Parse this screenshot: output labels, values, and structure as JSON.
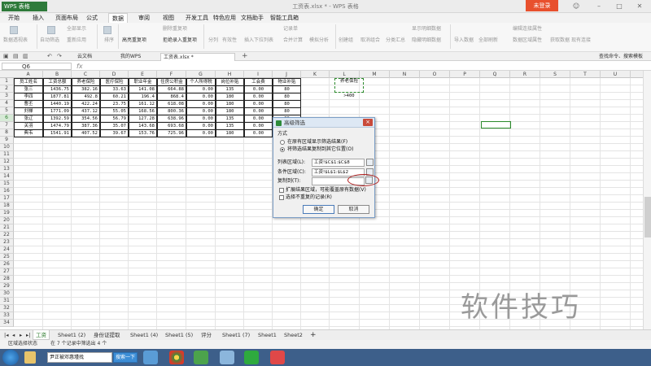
{
  "window": {
    "app_label": "WPS 表格",
    "title": "工资表.xlsx * - WPS 表格",
    "login_button": "未登录"
  },
  "menu": [
    "开始",
    "插入",
    "页面布局",
    "公式",
    "数据",
    "审阅",
    "视图",
    "开发工具",
    "特色应用",
    "文档助手",
    "智能工具箱"
  ],
  "ribbon": {
    "items": [
      "数据透视表",
      "自动筛选",
      "全部显示",
      "重新应用",
      "排序",
      "高亮重复项",
      "删除重复项",
      "拒绝录入重复项",
      "分列",
      "有效性",
      "插入下拉列表",
      "合并计算",
      "记录单",
      "模拟分析",
      "创建组",
      "取消组合",
      "分类汇总",
      "显示明细数据",
      "隐藏明细数据",
      "导入数据",
      "全部刷新",
      "编辑连接属性",
      "数据区域属性",
      "获取数据",
      "现有连接"
    ]
  },
  "quick_access_tabs": {
    "cloud": "云文档",
    "mywps": "我的WPS",
    "file": "工资表.xlsx *"
  },
  "name_box": "Q6",
  "fx_label": "fx",
  "search_hint": "查找命令、搜索模板",
  "columns": [
    "A",
    "B",
    "C",
    "D",
    "E",
    "F",
    "G",
    "H",
    "I",
    "J",
    "K",
    "L",
    "M",
    "N",
    "O",
    "P",
    "Q",
    "R",
    "S",
    "T",
    "U"
  ],
  "rows": [
    "1",
    "2",
    "3",
    "4",
    "5",
    "6",
    "7",
    "8",
    "9",
    "10",
    "11",
    "12",
    "13",
    "14",
    "15",
    "16",
    "17",
    "18",
    "19",
    "20",
    "21",
    "22",
    "23",
    "24",
    "25",
    "26",
    "27",
    "28",
    "29",
    "30",
    "31",
    "32",
    "33",
    "34"
  ],
  "table": {
    "headers": [
      "员工姓名",
      "工资总额",
      "养老保险",
      "医疗保险",
      "职业年金",
      "住房公积金",
      "个人所得税",
      "岗位补贴",
      "工会费",
      "物业补贴"
    ],
    "data": [
      [
        "张三",
        "1436.75",
        "382.16",
        "33.63",
        "141.08",
        "664.88",
        "0.00",
        "135",
        "0.00",
        "80"
      ],
      [
        "李四",
        "1877.81",
        "492.8",
        "60.21",
        "196.4",
        "868.4",
        "0.00",
        "180",
        "0.00",
        "80"
      ],
      [
        "曹丕",
        "1440.19",
        "422.24",
        "23.75",
        "161.12",
        "618.08",
        "0.00",
        "180",
        "0.00",
        "80"
      ],
      [
        "刘禅",
        "1771.09",
        "437.12",
        "55.05",
        "168.56",
        "800.36",
        "0.00",
        "180",
        "0.00",
        "80"
      ],
      [
        "张辽",
        "1392.59",
        "354.56",
        "56.79",
        "127.28",
        "638.96",
        "0.00",
        "135",
        "0.00",
        "80"
      ],
      [
        "关羽",
        "1474.79",
        "387.36",
        "35.07",
        "143.68",
        "693.68",
        "0.00",
        "135",
        "0.00",
        "80"
      ],
      [
        "典韦",
        "1541.91",
        "407.52",
        "39.67",
        "153.76",
        "725.96",
        "0.00",
        "180",
        "0.00",
        "80"
      ]
    ]
  },
  "criteria": {
    "header": "养老保险",
    "value": ">400"
  },
  "dialog": {
    "title": "高级筛选",
    "method_label": "方式",
    "option_in_place": "在原有区域显示筛选结果(F)",
    "option_copy": "将筛选结果复制到其它位置(O)",
    "list_range_label": "列表区域(L):",
    "list_range_value": "工资!$C$1:$C$8",
    "criteria_range_label": "条件区域(C):",
    "criteria_range_value": "工资!$L$1:$L$2",
    "copy_to_label": "复制到(T):",
    "copy_to_value": "",
    "expand_label": "扩展结果区域，可能覆盖原有数据(V)",
    "unique_label": "选择不重复的记录(R)",
    "ok": "确定",
    "cancel": "取消"
  },
  "sheets": [
    "工资",
    "Sheet1 (2)",
    "身份证提取",
    "Sheet1 (4)",
    "Sheet1 (5)",
    "评分",
    "Sheet1 (7)",
    "Sheet1",
    "Sheet2"
  ],
  "status_text": "区域选择状态",
  "status_count": "在 7 个记录中筛选出 4 个",
  "taskbar": {
    "search_text": "尹正被邓惠瑾找",
    "search_button": "搜索一下"
  },
  "watermark": "软件技巧",
  "colors": {
    "accent": "#2e7a3a",
    "login": "#e8502d",
    "highlight_oval": "#b01b1b",
    "selection": "#2b8a2b"
  }
}
